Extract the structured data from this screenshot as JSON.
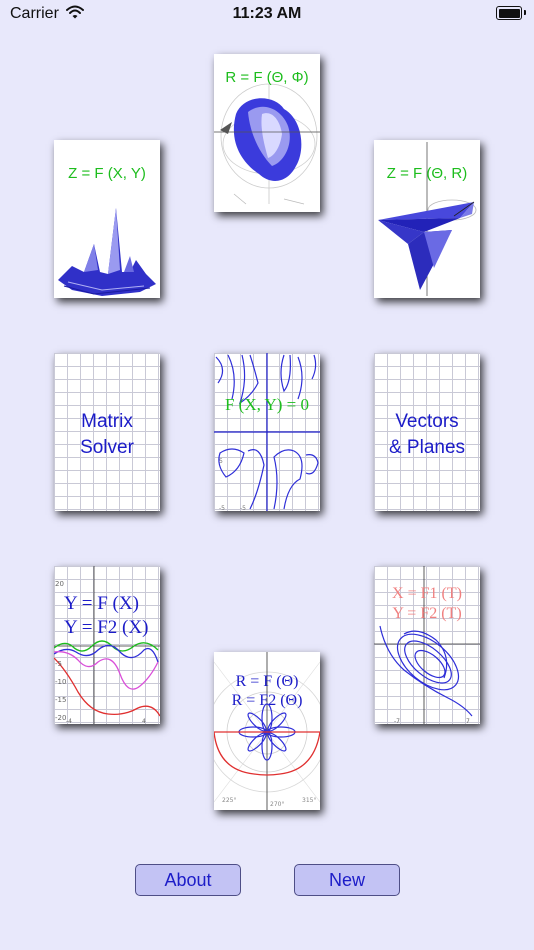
{
  "status_bar": {
    "carrier": "Carrier",
    "time": "11:23 AM"
  },
  "cards": {
    "spherical": {
      "label": "R = F (Θ, Φ)"
    },
    "surface": {
      "label": "Z = F (X, Y)"
    },
    "cylindrical": {
      "label": "Z = F (Θ, R)"
    },
    "matrix": {
      "line1": "Matrix",
      "line2": "Solver"
    },
    "implicit": {
      "label": "F (X, Y) = 0"
    },
    "vectors": {
      "line1": "Vectors",
      "line2": "& Planes"
    },
    "cartesian": {
      "line1": "Y = F (X)",
      "line2": "Y = F2 (X)"
    },
    "polar": {
      "line1": "R = F (Θ)",
      "line2": "R = F2 (Θ)"
    },
    "parametric": {
      "line1": "X = F1 (T)",
      "line2": "Y = F2 (T)"
    }
  },
  "buttons": {
    "about": "About",
    "new": "New"
  },
  "colors": {
    "background": "#e8e8fb",
    "button_fill": "#c3c3f4",
    "button_text": "#1c1cc8",
    "plot_blue": "#1a1ad0",
    "plot_green": "#1dbd1d",
    "plot_red": "#e03030",
    "plot_pink": "#f08080"
  },
  "icons": [
    "wifi-icon",
    "battery-icon"
  ]
}
